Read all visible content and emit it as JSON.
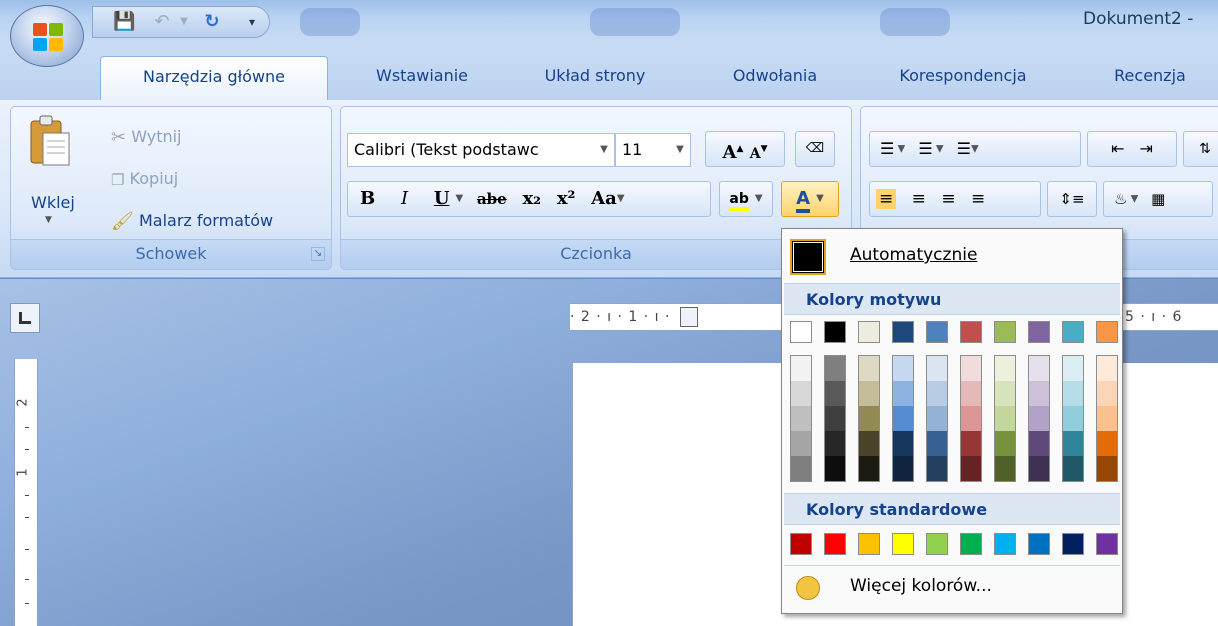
{
  "window": {
    "title": "Dokument2 -"
  },
  "tabs": [
    {
      "label": "Narzędzia główne",
      "active": true
    },
    {
      "label": "Wstawianie"
    },
    {
      "label": "Układ strony"
    },
    {
      "label": "Odwołania"
    },
    {
      "label": "Korespondencja"
    },
    {
      "label": "Recenzja"
    }
  ],
  "clipboard": {
    "paste_label": "Wklej",
    "cut_label": "Wytnij",
    "copy_label": "Kopiuj",
    "format_painter_label": "Malarz formatów",
    "group_label": "Schowek"
  },
  "font": {
    "font_name": "Calibri (Tekst podstawc",
    "font_size": "11",
    "group_label": "Czcionka",
    "bold": "B",
    "italic": "I",
    "underline": "U",
    "strike": "abe",
    "subscript": "x₂",
    "superscript": "x²",
    "change_case": "Aa",
    "grow": "A",
    "shrink": "A",
    "highlight": "ab",
    "font_color": "A"
  },
  "ruler": {
    "h_text": "· 2 · ı · 1 · ı ·",
    "h_text_right": "5 · ı · 6",
    "v_num": "2",
    "v_num2": "1"
  },
  "color_menu": {
    "auto_label": "Automatycznie",
    "theme_header": "Kolory motywu",
    "standard_header": "Kolory standardowe",
    "more_label": "Więcej kolorów...",
    "theme_top": [
      "#ffffff",
      "#000000",
      "#eeece1",
      "#1f497d",
      "#4f81bd",
      "#c0504d",
      "#9bbb59",
      "#8064a2",
      "#4bacc6",
      "#f79646"
    ],
    "theme_shades": [
      [
        "#f2f2f2",
        "#d8d8d8",
        "#bfbfbf",
        "#a5a5a5",
        "#7f7f7f"
      ],
      [
        "#7f7f7f",
        "#595959",
        "#3f3f3f",
        "#262626",
        "#0c0c0c"
      ],
      [
        "#ddd9c3",
        "#c4bd97",
        "#938953",
        "#494429",
        "#1d1b10"
      ],
      [
        "#c6d9f0",
        "#8db3e2",
        "#548dd4",
        "#17365d",
        "#0f243e"
      ],
      [
        "#dbe5f1",
        "#b8cce4",
        "#95b3d7",
        "#366092",
        "#244061"
      ],
      [
        "#f2dcdb",
        "#e5b9b7",
        "#d99694",
        "#953734",
        "#632423"
      ],
      [
        "#ebf1dd",
        "#d7e3bc",
        "#c3d69b",
        "#76923c",
        "#4f6128"
      ],
      [
        "#e5e0ec",
        "#ccc1d9",
        "#b2a2c7",
        "#5f497a",
        "#3f3151"
      ],
      [
        "#dbeef3",
        "#b7dde8",
        "#92cddc",
        "#31859b",
        "#205867"
      ],
      [
        "#fdeada",
        "#fbd5b5",
        "#fac08f",
        "#e36c09",
        "#974806"
      ]
    ],
    "standard": [
      "#c00000",
      "#ff0000",
      "#ffc000",
      "#ffff00",
      "#92d050",
      "#00b050",
      "#00b0f0",
      "#0070c0",
      "#002060",
      "#7030a0"
    ]
  }
}
